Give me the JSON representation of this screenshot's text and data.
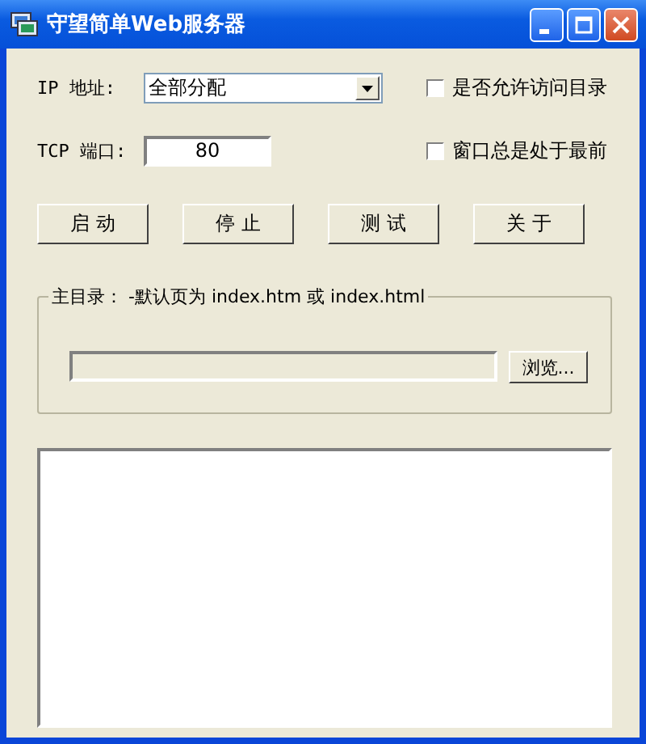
{
  "window": {
    "title": "守望简单Web服务器"
  },
  "ip": {
    "label": "IP 地址:",
    "value": "全部分配"
  },
  "port": {
    "label": "TCP 端口:",
    "value": "80"
  },
  "options": [
    {
      "label": "是否允许访问目录",
      "checked": false
    },
    {
      "label": "窗口总是处于最前",
      "checked": false
    }
  ],
  "buttons": [
    "启 动",
    "停 止",
    "测 试",
    "关 于"
  ],
  "home_dir": {
    "legend": "主目录： -默认页为 index.htm 或 index.html",
    "browse_button": "浏览..."
  }
}
